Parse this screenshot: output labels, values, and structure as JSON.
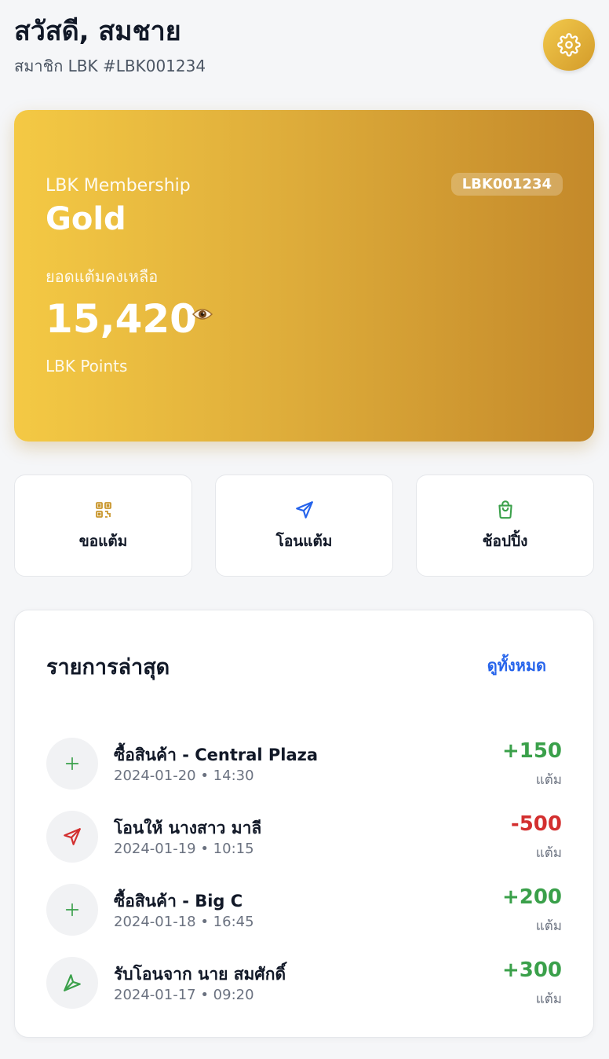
{
  "header": {
    "greeting": "สวัสดี, สมชาย",
    "member_line": "สมาชิก LBK #LBK001234",
    "settings_icon": "gear-icon"
  },
  "card": {
    "brand": "LBK Membership",
    "tier": "Gold",
    "member_id": "LBK001234",
    "balance_label": "ยอดแต้มคงเหลือ",
    "balance_value": "15,420",
    "eye_icon": "eye-icon",
    "points_unit": "LBK Points",
    "gradient_start": "#f4c944",
    "gradient_end": "#c4892a"
  },
  "actions": [
    {
      "label": "ขอแต้ม",
      "icon": "qr-code-icon",
      "color": "#c9962c"
    },
    {
      "label": "โอนแต้ม",
      "icon": "send-icon",
      "color": "#2563eb"
    },
    {
      "label": "ช้อปปิ้ง",
      "icon": "shopping-bag-icon",
      "color": "#3aa04a"
    }
  ],
  "transactions": {
    "title": "รายการล่าสุด",
    "view_all": "ดูทั้งหมด",
    "items": [
      {
        "name": "ซื้อสินค้า - Central Plaza",
        "time": "2024-01-20 • 14:30",
        "amount": "+150",
        "unit": "แต้ม",
        "icon": "plus-icon",
        "type": "positive"
      },
      {
        "name": "โอนให้ นางสาว มาลี",
        "time": "2024-01-19 • 10:15",
        "amount": "-500",
        "unit": "แต้ม",
        "icon": "send-out-icon",
        "type": "negative"
      },
      {
        "name": "ซื้อสินค้า - Big C",
        "time": "2024-01-18 • 16:45",
        "amount": "+200",
        "unit": "แต้ม",
        "icon": "plus-icon",
        "type": "positive"
      },
      {
        "name": "รับโอนจาก นาย สมศักดิ์",
        "time": "2024-01-17 • 09:20",
        "amount": "+300",
        "unit": "แต้ม",
        "icon": "receive-icon",
        "type": "positive"
      }
    ]
  },
  "colors": {
    "accent_blue": "#2563eb",
    "positive": "#3aa04a",
    "negative": "#d32f2f"
  }
}
